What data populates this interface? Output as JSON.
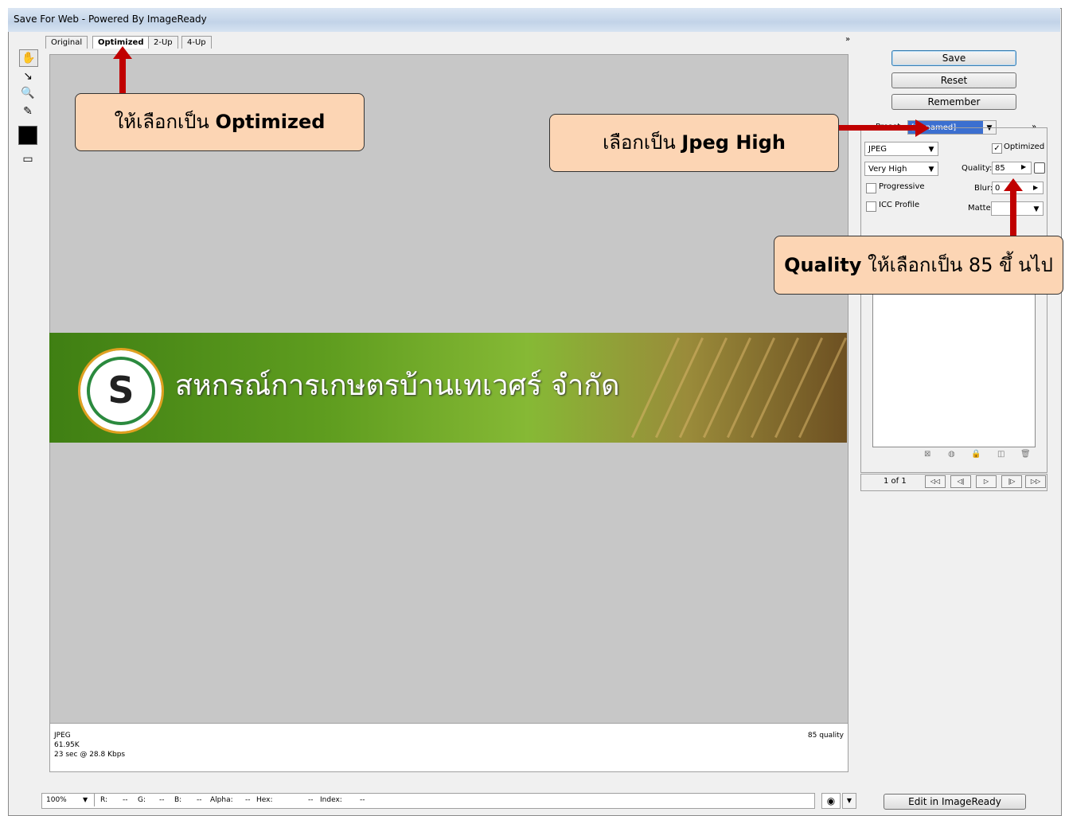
{
  "window": {
    "title": "Save For Web - Powered By ImageReady"
  },
  "tabs": [
    {
      "label": "Original"
    },
    {
      "label": "Optimized"
    },
    {
      "label": "2-Up"
    },
    {
      "label": "4-Up"
    }
  ],
  "tools": {
    "hand": "hand-tool-icon",
    "slice_select": "slice-select-tool-icon",
    "zoom": "zoom-tool-icon",
    "eyedropper": "eyedropper-tool-icon",
    "eyedropper_color": "#000000",
    "preview": "browser-preview-icon"
  },
  "expand_glyph": "»",
  "buttons": {
    "save": "Save",
    "reset": "Reset",
    "remember": "Remember",
    "edit": "Edit in ImageReady"
  },
  "settings": {
    "preset_label": "Preset:",
    "preset_value": "[Unnamed]",
    "format": "JPEG",
    "quality_preset": "Very High",
    "optimized_label": "Optimized",
    "optimized_checked": true,
    "quality_label": "Quality:",
    "quality_value": "85",
    "blur_label": "Blur:",
    "blur_value": "0",
    "matte_label": "Matte:",
    "progressive_label": "Progressive",
    "progressive_checked": false,
    "icc_label": "ICC Profile",
    "icc_checked": false
  },
  "banner": {
    "text": "สหกรณ์การเกษตรบ้านเทเวศร์ จำกัด",
    "logo_glyph": "S"
  },
  "info": {
    "format": "JPEG",
    "size": "61.95K",
    "time": "23 sec @ 28.8 Kbps",
    "quality": "85 quality"
  },
  "animation": {
    "frame": "1 of 1"
  },
  "status": {
    "zoom": "100%",
    "r": "R:",
    "r_val": "--",
    "g": "G:",
    "g_val": "--",
    "b": "B:",
    "b_val": "--",
    "alpha": "Alpha:",
    "alpha_val": "--",
    "hex": "Hex:",
    "hex_val": "--",
    "index": "Index:",
    "index_val": "--"
  },
  "annotations": {
    "optimized": {
      "prefix": "ให้เลือกเป็น ",
      "bold": "Optimized"
    },
    "jpeg": {
      "prefix": "เลือกเป็น ",
      "bold": "Jpeg High"
    },
    "quality": {
      "bold": "Quality",
      "suffix": " ให้เลือกเป็น 85 ขึ้ นไป"
    },
    "color": "#c00000",
    "fill": "#fcd5b4"
  }
}
